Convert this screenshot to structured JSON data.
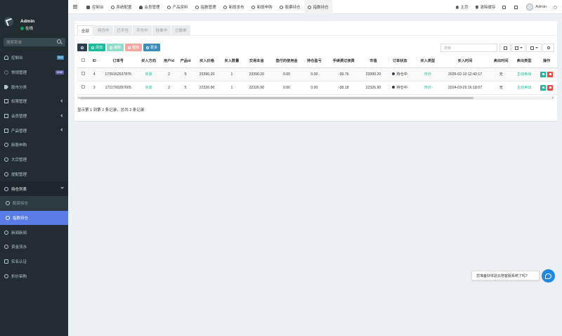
{
  "user": {
    "name": "Admin",
    "status": "在线"
  },
  "sidebar": {
    "search_placeholder": "搜索菜单",
    "items": [
      {
        "label": "控制台",
        "badge": "hot"
      },
      {
        "label": "常规管理",
        "badge": "new"
      },
      {
        "label": "股市分类"
      },
      {
        "label": "权限管理"
      },
      {
        "label": "会员管理"
      },
      {
        "label": "产品管理"
      },
      {
        "label": "新股申购"
      },
      {
        "label": "大宗管理"
      },
      {
        "label": "提配管理"
      },
      {
        "label": "持仓列表"
      },
      {
        "label": "配资持仓"
      },
      {
        "label": "指数持仓"
      },
      {
        "label": "新闻新闻"
      },
      {
        "label": "资金流水"
      },
      {
        "label": "实名认证"
      },
      {
        "label": "折价审购"
      }
    ]
  },
  "topnav": {
    "tabs": [
      "控制台",
      "系统配置",
      "会员管理",
      "产品资料",
      "指数管理",
      "新股发布",
      "新股申购",
      "股票持仓",
      "指数持仓"
    ],
    "home": "主页",
    "clear_cache": "清除缓存",
    "admin": "Admin"
  },
  "filter_tabs": [
    "全部",
    "持仓中",
    "已平仓",
    "平仓中",
    "挂单中",
    "已撤单"
  ],
  "toolbar": {
    "add": "添加",
    "edit": "编辑",
    "delete": "删除",
    "more": "更多",
    "search_placeholder": "搜索"
  },
  "table": {
    "headers": [
      "ID",
      "订单号",
      "买入方向",
      "用户id",
      "产品id",
      "买入价格",
      "买入数量",
      "交易本金",
      "垫付的使用金",
      "持仓盈亏",
      "手续费过夜费",
      "市值",
      "订单状态",
      "买入类型",
      "买入时间",
      "卖出时间",
      "卖出类型",
      "操作"
    ],
    "rows": [
      {
        "id": "4",
        "order_no": "1739162537876",
        "direction": "买涨",
        "user_id": "2",
        "product_id": "5",
        "buy_price": "23390.20",
        "quantity": "1",
        "principal": "23390.20",
        "advance": "0.00",
        "pnl": "0.00",
        "fees": "-39.76",
        "market_value": "23390.20",
        "status": "持仓中",
        "buy_type": "市价",
        "buy_time": "2025-02-10 12:42:17",
        "sell_time": "无",
        "sell_type": "主动卖出"
      },
      {
        "id": "3",
        "order_no": "1711700287665",
        "direction": "买涨",
        "user_id": "2",
        "product_id": "5",
        "buy_price": "22326.90",
        "quantity": "1",
        "principal": "22326.90",
        "advance": "0.00",
        "pnl": "0.00",
        "fees": "-38.18",
        "market_value": "22326.90",
        "status": "持仓中",
        "buy_type": "市价",
        "buy_time": "2024-03-29 16:18:07",
        "sell_time": "无",
        "sell_type": "主动卖出"
      }
    ]
  },
  "pagination_text": "显示第 1 到第 2 条记录，总共 2 条记录",
  "chat": {
    "text": "您准备好体验云陪客服系统了吗?"
  }
}
